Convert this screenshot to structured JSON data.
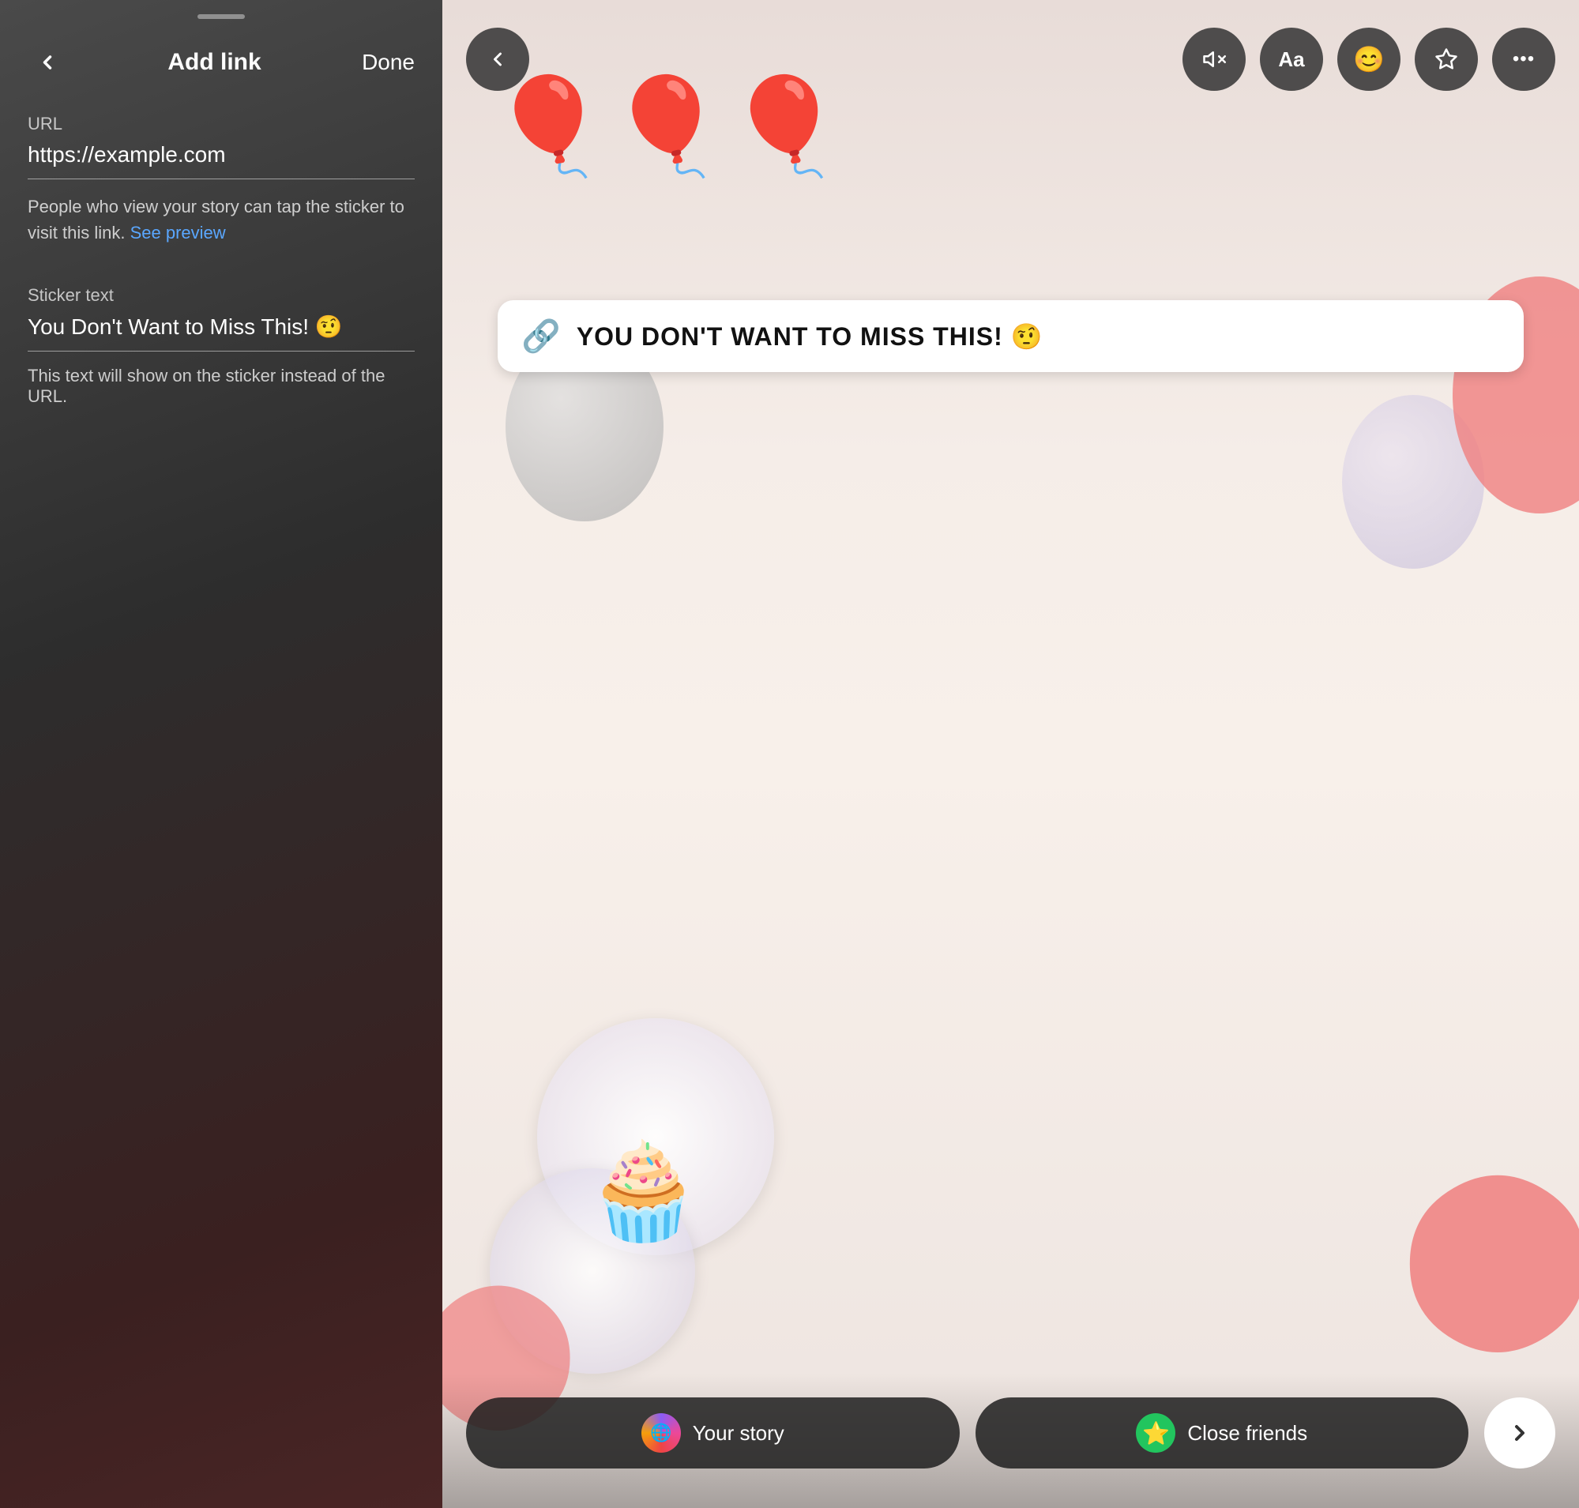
{
  "left_panel": {
    "drag_handle_visible": true,
    "header": {
      "back_label": "←",
      "title": "Add link",
      "done_label": "Done"
    },
    "url_section": {
      "label": "URL",
      "value": "https://example.com",
      "description_part1": "People who view your story can tap the sticker to visit this link. ",
      "description_link": "See preview"
    },
    "sticker_section": {
      "label": "Sticker text",
      "value": "You Don't Want to Miss This! 🤨",
      "description": "This text will show on the sticker instead of the URL."
    }
  },
  "right_panel": {
    "toolbar": {
      "back_label": "‹",
      "mute_icon": "🔇",
      "text_icon": "Aa",
      "sticker_icon": "☺",
      "effects_icon": "✦",
      "more_icon": "···"
    },
    "sticker": {
      "link_icon": "🔗",
      "text": "YOU DON'T WANT TO MISS THIS! 🤨"
    },
    "bottom_bar": {
      "your_story_label": "Your story",
      "close_friends_label": "Close friends",
      "next_label": "›"
    }
  }
}
